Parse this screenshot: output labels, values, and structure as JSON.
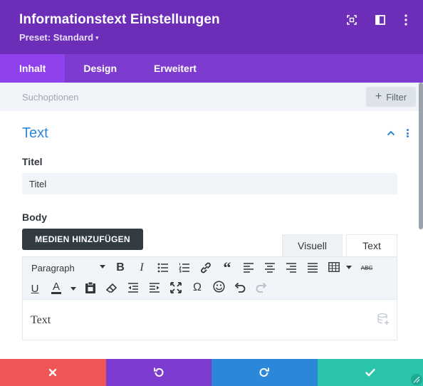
{
  "header": {
    "title": "Informationstext Einstellungen",
    "preset_label": "Preset: Standard",
    "preset_caret": "▾",
    "background_color": "#6c2eb9",
    "icons": [
      "fullscreen-icon",
      "split-view-icon",
      "more-vertical-icon"
    ]
  },
  "tabs": [
    {
      "label": "Inhalt",
      "active": true
    },
    {
      "label": "Design",
      "active": false
    },
    {
      "label": "Erweitert",
      "active": false
    }
  ],
  "search": {
    "placeholder": "Suchoptionen",
    "filter_label": "Filter",
    "filter_icon": "plus-icon"
  },
  "section": {
    "title": "Text",
    "accent_color": "#2b87da",
    "expanded": true
  },
  "fields": {
    "title_label": "Titel",
    "title_value": "Titel",
    "body_label": "Body"
  },
  "editor": {
    "media_button": "MEDIEN HINZUFÜGEN",
    "tab_visual": "Visuell",
    "tab_text": "Text",
    "paragraph_select": "Paragraph",
    "content": "Text",
    "toolbar_row1": [
      "bold-icon",
      "italic-icon",
      "bullet-list-icon",
      "numbered-list-icon",
      "link-icon",
      "quote-icon",
      "align-left-icon",
      "align-center-icon",
      "align-right-icon",
      "justify-icon",
      "table-icon",
      "strikethrough-icon"
    ],
    "toolbar_row2": [
      "underline-icon",
      "text-color-icon",
      "paste-icon",
      "eraser-icon",
      "outdent-icon",
      "indent-icon",
      "fullscreen-icon",
      "omega-icon",
      "emoji-icon",
      "undo-icon",
      "redo-icon"
    ],
    "strikethrough_label": "ABC",
    "omega_label": "Ω"
  },
  "footer": {
    "buttons": [
      "cancel",
      "undo",
      "redo",
      "save"
    ],
    "colors": {
      "cancel": "#ef5555",
      "undo": "#7e3bd0",
      "redo": "#2b87da",
      "save": "#29c4a9"
    }
  }
}
